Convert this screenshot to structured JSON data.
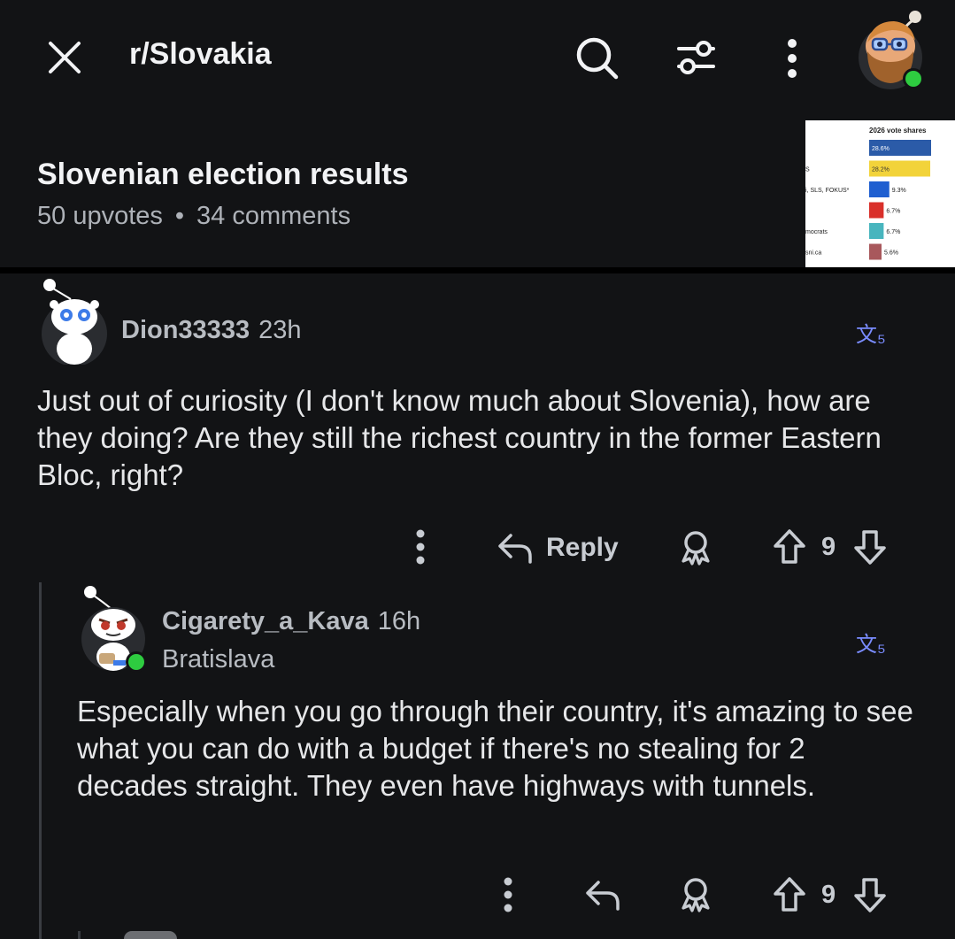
{
  "header": {
    "subreddit": "r/Slovakia",
    "close_icon": "close-icon",
    "search_icon": "search-icon",
    "filter_icon": "filter-icon",
    "more_icon": "more-vertical-icon"
  },
  "post": {
    "title": "Slovenian election results",
    "upvotes": "50 upvotes",
    "separator": "•",
    "comments": "34 comments",
    "thumbnail": {
      "title": "2026 vote shares",
      "rows": [
        {
          "label": "",
          "value": "28.6%",
          "color": "#2b5ba8"
        },
        {
          "label": "S",
          "value": "28.2%",
          "color": "#f2d33a"
        },
        {
          "label": "i, SLS, FOKUS*",
          "value": "9.3%",
          "color": "#1f5fd0"
        },
        {
          "label": "",
          "value": "6.7%",
          "color": "#d9302a"
        },
        {
          "label": "mocrats",
          "value": "6.7%",
          "color": "#48b5be"
        },
        {
          "label": "sni.ca",
          "value": "5.6%",
          "color": "#a8585c"
        }
      ]
    }
  },
  "comments": [
    {
      "author": "Dion33333",
      "time": "23h",
      "flair": "",
      "text": "Just out of curiosity (I don't know much about Slovenia), how are they doing? Are they still the richest country in the former Eastern Bloc, right?",
      "reply_label": "Reply",
      "votes": "9",
      "translate_glyph": "文₅"
    },
    {
      "author": "Cigarety_a_Kava",
      "time": "16h",
      "flair": "Bratislava",
      "text": "Especially when you go through their country, it's amazing to see what you can do with a budget if there's no stealing for 2 decades straight. They even have highways with tunnels.",
      "votes": "9",
      "translate_glyph": "文₅"
    }
  ],
  "colors": {
    "background": "#121315",
    "online": "#2ecc40",
    "translate": "#7a8cff"
  }
}
